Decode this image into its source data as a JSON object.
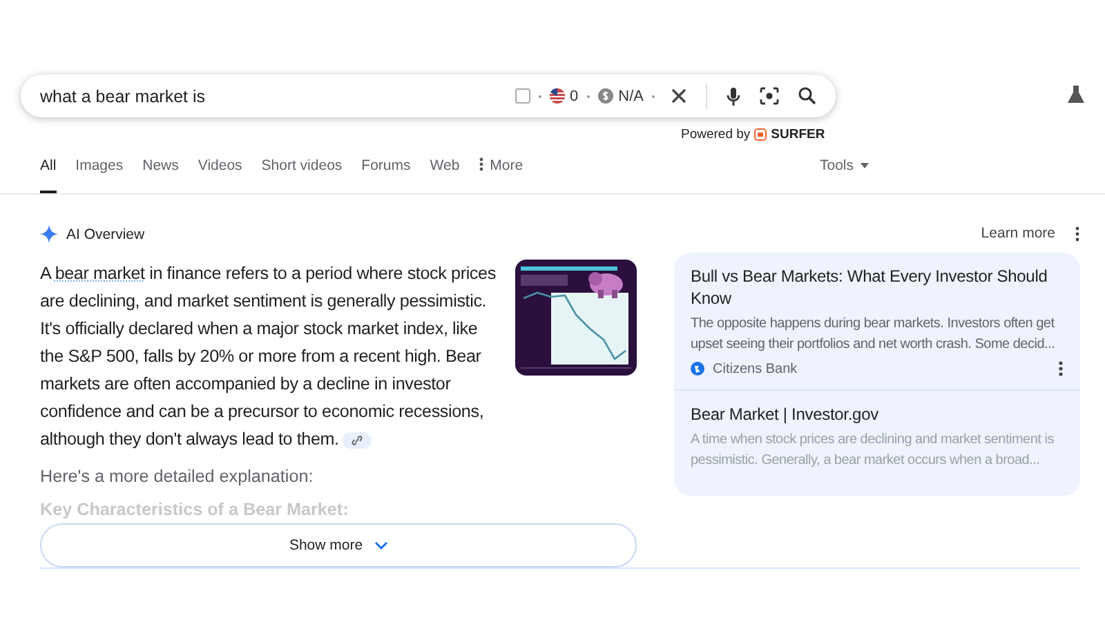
{
  "search": {
    "value": "what a bear market is",
    "checkbox": {
      "checked": false
    },
    "flag_count": "0",
    "price": "N/A"
  },
  "powered_by": {
    "label": "Powered by",
    "brand": "SURFER"
  },
  "tabs": [
    {
      "label": "All",
      "selected": true
    },
    {
      "label": "Images",
      "selected": false
    },
    {
      "label": "News",
      "selected": false
    },
    {
      "label": "Videos",
      "selected": false
    },
    {
      "label": "Short videos",
      "selected": false
    },
    {
      "label": "Forums",
      "selected": false
    },
    {
      "label": "Web",
      "selected": false
    },
    {
      "label": "More",
      "selected": false,
      "kind": "menu"
    }
  ],
  "tools": "Tools",
  "ai_overview": {
    "title": "AI Overview",
    "learn_more": "Learn more",
    "paragraph": {
      "before": "A ",
      "link": "bear market",
      "after": " in finance refers to a period where stock prices are declining, and market sentiment is generally pessimistic. It's officially declared when a major stock market index, like the S&P 500, falls by 20% or more from a recent high. Bear markets are often accompanied by a decline in investor confidence and can be a precursor to economic recessions, although they don't always lead to them."
    },
    "detail_intro": "Here's a more detailed explanation:",
    "faded_heading": "Key Characteristics of a Bear Market:",
    "show_more": "Show more",
    "sources": [
      {
        "title": "Bull vs Bear Markets: What Every Investor Should Know",
        "snippet": "The opposite happens during bear markets. Investors often get upset seeing their portfolios and net worth crash. Some decid...",
        "site": "Citizens Bank"
      },
      {
        "title": "Bear Market | Investor.gov",
        "snippet": "A time when stock prices are declining and market sentiment is pessimistic. Generally, a bear market occurs when a broad..."
      }
    ]
  }
}
